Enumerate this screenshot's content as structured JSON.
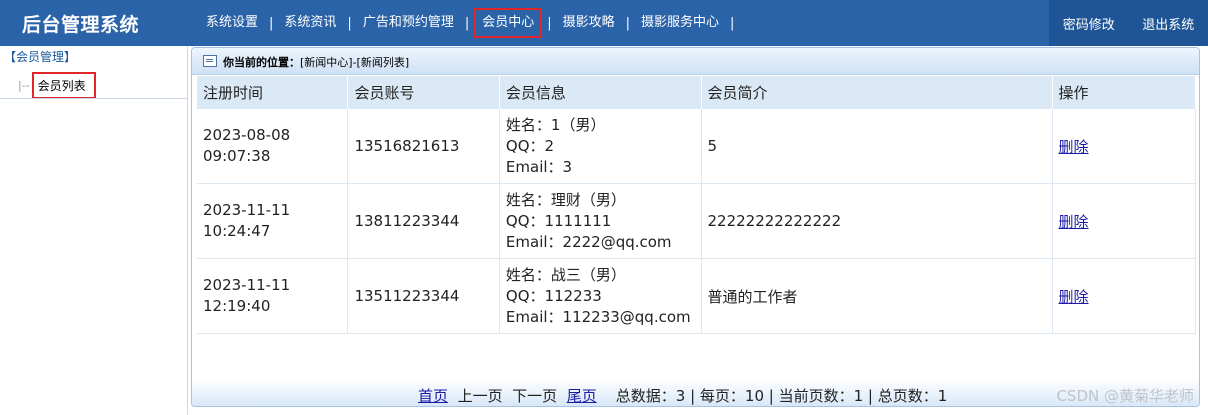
{
  "header": {
    "brand": "后台管理系统",
    "nav": [
      "系统设置",
      "系统资讯",
      "广告和预约管理",
      "会员中心",
      "摄影攻略",
      "摄影服务中心"
    ],
    "active_index": 3,
    "separator": "|",
    "right_links": [
      "密码修改",
      "退出系统"
    ]
  },
  "sidebar": {
    "group_title": "【会员管理】",
    "tree_prefix": "|--",
    "item": "会员列表"
  },
  "location": {
    "label": "你当前的位置：",
    "path": "[新闻中心]-[新闻列表]"
  },
  "table": {
    "headers": [
      "注册时间",
      "会员账号",
      "会员信息",
      "会员简介",
      "操作"
    ],
    "rows": [
      {
        "time_date": "2023-08-08",
        "time_clock": "09:07:38",
        "account": "13516821613",
        "info_name": "姓名：1（男）",
        "info_qq": "QQ：2",
        "info_email": "Email：3",
        "intro": "5",
        "action": "删除"
      },
      {
        "time_date": "2023-11-11",
        "time_clock": "10:24:47",
        "account": "13811223344",
        "info_name": "姓名：理财（男）",
        "info_qq": "QQ：1111111",
        "info_email": "Email：2222@qq.com",
        "intro": "22222222222222",
        "action": "删除"
      },
      {
        "time_date": "2023-11-11",
        "time_clock": "12:19:40",
        "account": "13511223344",
        "info_name": "姓名：战三（男）",
        "info_qq": "QQ：112233",
        "info_email": "Email：112233@qq.com",
        "intro": "普通的工作者",
        "action": "删除"
      }
    ]
  },
  "pager": {
    "first": "首页",
    "prev": "上一页",
    "next": "下一页",
    "last": "尾页",
    "summary": "总数据：3 | 每页：10 | 当前页数：1 | 总页数：1"
  },
  "watermark": "CSDN @黄菊华老师"
}
